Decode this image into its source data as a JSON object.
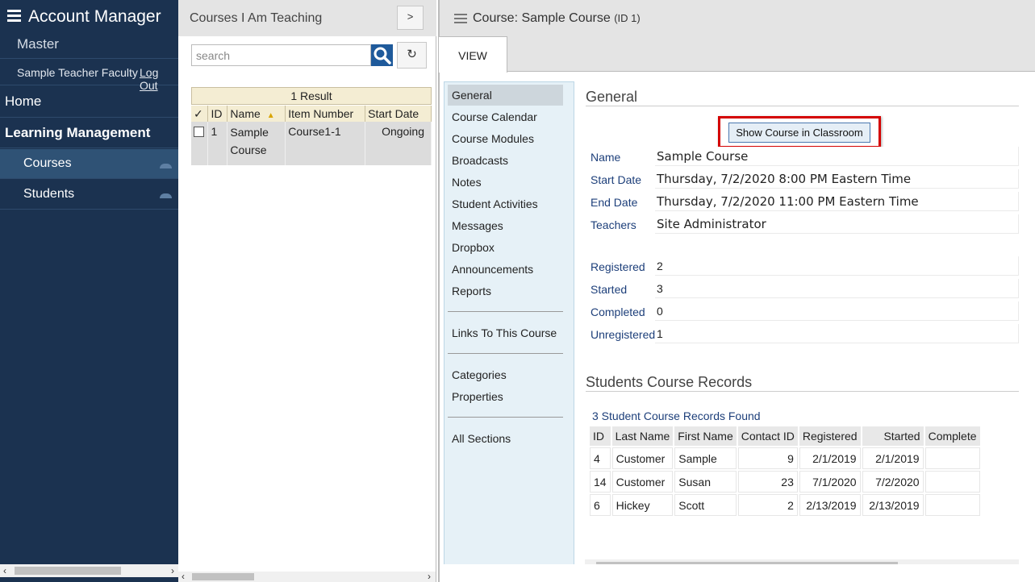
{
  "sidebar": {
    "app_title": "Account Manager",
    "account": "Master",
    "user_name": "Sample Teacher Faculty",
    "logout_label": "Log Out",
    "nav": {
      "home": "Home",
      "section": "Learning Management",
      "courses": "Courses",
      "students": "Students"
    }
  },
  "list_panel": {
    "title": "Courses I Am Teaching",
    "expand_label": ">",
    "search_placeholder": "search",
    "search_value": "",
    "refresh_icon": "↻",
    "result_count": "1 Result",
    "columns": [
      "✓",
      "ID",
      "Name",
      "Item Number",
      "Start Date"
    ],
    "rows": [
      {
        "id": "1",
        "name": "Sample Course",
        "item_number": "Course1-1",
        "start_date": "Ongoing"
      }
    ]
  },
  "course": {
    "title": "Course: Sample Course",
    "id_label": "(ID 1)",
    "tab_view": "VIEW",
    "section_nav": {
      "general": "General",
      "course_calendar": "Course Calendar",
      "course_modules": "Course Modules",
      "broadcasts": "Broadcasts",
      "notes": "Notes",
      "student_activities": "Student Activities",
      "messages": "Messages",
      "dropbox": "Dropbox",
      "announcements": "Announcements",
      "reports": "Reports",
      "links": "Links To This Course",
      "categories": "Categories",
      "properties": "Properties",
      "all_sections": "All Sections"
    },
    "general_heading": "General",
    "show_classroom_label": "Show Course in Classroom",
    "fields": {
      "name_label": "Name",
      "name_value": "Sample Course",
      "start_label": "Start Date",
      "start_value": "Thursday, 7/2/2020 8:00 PM Eastern Time",
      "end_label": "End Date",
      "end_value": "Thursday, 7/2/2020 11:00 PM Eastern Time",
      "teachers_label": "Teachers",
      "teachers_value": "Site Administrator"
    },
    "stats": {
      "registered_label": "Registered",
      "registered_value": "2",
      "started_label": "Started",
      "started_value": "3",
      "completed_label": "Completed",
      "completed_value": "0",
      "unregistered_label": "Unregistered",
      "unregistered_value": "1"
    },
    "records_heading": "Students Course Records",
    "records_found": "3 Student Course Records Found",
    "records_columns": [
      "ID",
      "Last Name",
      "First Name",
      "Contact ID",
      "Registered",
      "Started",
      "Complete"
    ],
    "records": [
      {
        "id": "4",
        "last": "Customer",
        "first": "Sample",
        "contact": "9",
        "registered": "2/1/2019",
        "started": "2/1/2019",
        "complete": ""
      },
      {
        "id": "14",
        "last": "Customer",
        "first": "Susan",
        "contact": "23",
        "registered": "7/1/2020",
        "started": "7/2/2020",
        "complete": ""
      },
      {
        "id": "6",
        "last": "Hickey",
        "first": "Scott",
        "contact": "2",
        "registered": "2/13/2019",
        "started": "2/13/2019",
        "complete": ""
      }
    ]
  },
  "colors": {
    "sidebar_bg": "#1b3250",
    "sidebar_active": "#2f5275",
    "header_bg": "#e4e4e4",
    "accent_blue": "#1f5a9b",
    "highlight_red": "#d40000",
    "result_bar": "#f4edd3"
  },
  "icons": {
    "menu": "hamburger-icon",
    "search": "magnifier-icon",
    "refresh": "refresh-icon",
    "drawer": "drawer-icon"
  }
}
